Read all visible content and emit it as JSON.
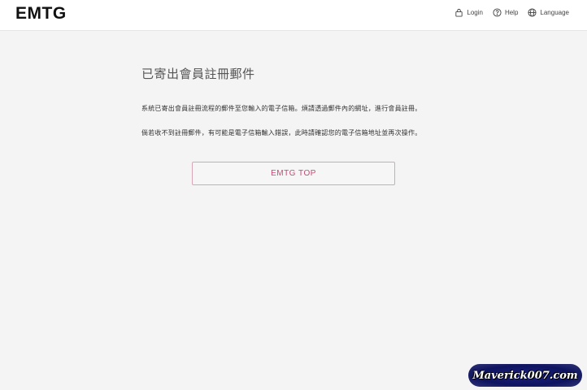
{
  "header": {
    "logo": "EMTG",
    "nav": [
      {
        "icon": "lock-icon",
        "label": "Login"
      },
      {
        "icon": "help-icon",
        "label": "Help"
      },
      {
        "icon": "globe-icon",
        "label": "Language"
      }
    ]
  },
  "main": {
    "title": "已寄出會員註冊郵件",
    "paragraph1": "系統已寄出會員註冊流程的郵件至您輸入的電子信箱。煩請透過郵件內的網址，進行會員註冊。",
    "paragraph2": "倘若收不到註冊郵件，有可能是電子信箱輸入錯誤，此時請確認您的電子信箱地址並再次操作。",
    "button_label": "EMTG TOP"
  },
  "watermark": "Maverick007.com",
  "colors": {
    "accent": "#c64a73",
    "button_border": "#d9a6b5",
    "background": "#f4f4f4"
  }
}
